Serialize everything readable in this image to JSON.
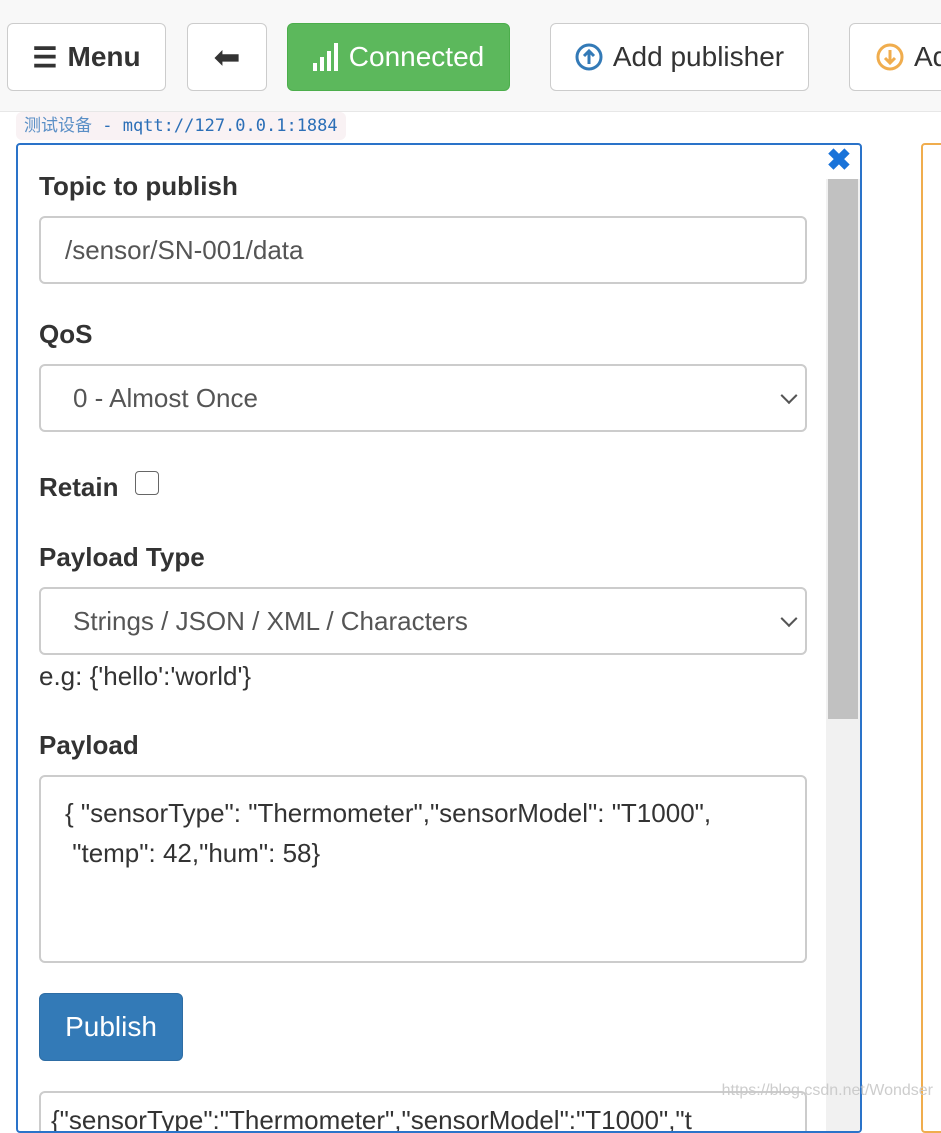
{
  "toolbar": {
    "menu": "Menu",
    "connected": "Connected",
    "add_publisher": "Add publisher",
    "add_subscriber": "Ad"
  },
  "connection": {
    "name": "测试设备",
    "url": " - mqtt://127.0.0.1:1884"
  },
  "publisher": {
    "topic_label": "Topic to publish",
    "topic_value": "/sensor/SN-001/data",
    "qos_label": "QoS",
    "qos_value": "0 - Almost Once",
    "retain_label": "Retain",
    "retain_checked": false,
    "payload_type_label": "Payload Type",
    "payload_type_value": "Strings / JSON / XML / Characters",
    "payload_hint": "e.g: {'hello':'world'}",
    "payload_label": "Payload",
    "payload_value": "{ \"sensorType\": \"Thermometer\",\"sensorModel\": \"T1000\",\n \"temp\": 42,\"hum\": 58}",
    "publish_label": "Publish",
    "last_message": "{\"sensorType\":\"Thermometer\",\"sensorModel\":\"T1000\",\"t"
  },
  "watermark": "https://blog.csdn.net/Wondser",
  "colors": {
    "connected": "#5cb85c",
    "primary": "#337ab7",
    "publisher_border": "#2a73c9",
    "subscriber_border": "#f0ad4e"
  }
}
